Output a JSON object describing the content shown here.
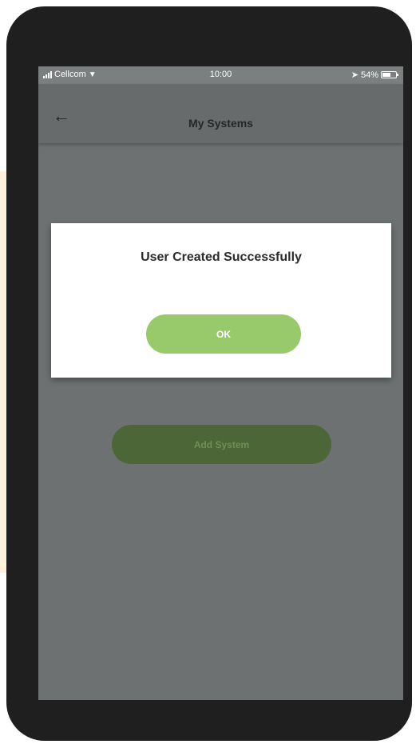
{
  "status_bar": {
    "carrier": "Cellcom",
    "time": "10:00",
    "battery": "54%"
  },
  "nav": {
    "title": "My Systems"
  },
  "main": {
    "add_system_label": "Add System"
  },
  "dialog": {
    "message": "User Created Successfully",
    "ok_label": "OK"
  },
  "colors": {
    "accent_green": "#98c96b",
    "overlay_gray": "#6d7171"
  }
}
